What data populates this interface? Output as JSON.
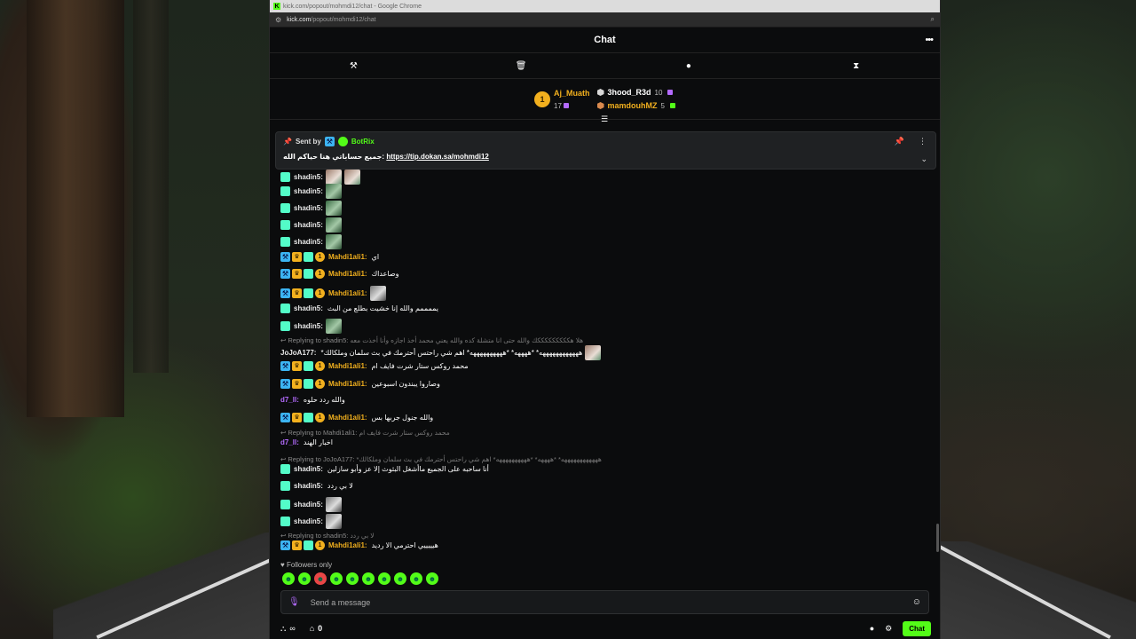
{
  "browser": {
    "title": "kick.com/popout/mohmdi12/chat - Google Chrome",
    "url_host": "kick.com",
    "url_path": "/popout/mohmdi12/chat"
  },
  "header": {
    "title": "Chat"
  },
  "leaderboard": {
    "first": {
      "rank": "1",
      "name": "Aj_Muath",
      "count": "17"
    },
    "second": {
      "name": "3hood_R3d",
      "count": "10"
    },
    "third": {
      "name": "mamdouhMZ",
      "count": "5"
    }
  },
  "pinned": {
    "sent_by": "Sent by",
    "bot": "BotRix",
    "text": "جميع حساباتي هنا حياكم الله:",
    "link": "https://tip.dokan.sa/mohmdi12"
  },
  "messages": [
    {
      "user": "shadin5:",
      "text": ""
    },
    {
      "user": "shadin5:",
      "text": ""
    },
    {
      "user": "shadin5:",
      "text": ""
    },
    {
      "user": "shadin5:",
      "text": ""
    },
    {
      "user": "shadin5:",
      "text": ""
    },
    {
      "user": "Mahdi1ali1:",
      "text": "اي"
    },
    {
      "user": "Mahdi1ali1:",
      "text": "وصاعداك"
    },
    {
      "user": "Mahdi1ali1:",
      "text": ""
    },
    {
      "user": "shadin5:",
      "text": "يممممم والله إنا خشيت بطلع من البث"
    },
    {
      "user": "shadin5:",
      "text": ""
    },
    {
      "user": "JoJoA177:",
      "text": "*ههههههههههههه* *ههههه* *ههههههههههه* اهم شي راحتس أحترمك في بث سلمان وملكالك"
    },
    {
      "user": "Mahdi1ali1:",
      "text": "محمد روكس ستار شرت فايف ام"
    },
    {
      "user": "Mahdi1ali1:",
      "text": "وصاروا يبندون اسبوعين"
    },
    {
      "user": "d7_ll:",
      "text": "والله ردد حلوه"
    },
    {
      "user": "Mahdi1ali1:",
      "text": "والله جنول جربها بس"
    },
    {
      "user": "d7_ll:",
      "text": "اخبار الهند"
    },
    {
      "user": "shadin5:",
      "text": "أنا ساحبه على الجميع ماأشغل البثوث إلا عز وأبو سازلين"
    },
    {
      "user": "shadin5:",
      "text": "لا بي ردد"
    },
    {
      "user": "shadin5:",
      "text": ""
    },
    {
      "user": "shadin5:",
      "text": ""
    },
    {
      "user": "Mahdi1ali1:",
      "text": "هيييييي احترمي الا رديد"
    }
  ],
  "replies": [
    {
      "label": "Replying to shadin5:",
      "context": "هلا هكككككككككك والله حتى انا متشلة كده والله يعني محمد أخذ اجازه وأنا أخذت معه"
    },
    {
      "label": "Replying to Mahdi1ali1:",
      "context": "محمد روكس ستار شرت فايف ام"
    },
    {
      "label": "Replying to JoJoA177:",
      "context": "*ههههههههههههه* *ههههه* *ههههههههههه* اهم شي راحتس أحترمك في بث سلمان وملكالك"
    },
    {
      "label": "Replying to shadin5:",
      "context": "لا بي ردد"
    }
  ],
  "composer": {
    "followers_only": "Followers only",
    "placeholder": "Send a message",
    "points": "0",
    "chat_button": "Chat"
  },
  "colors": {
    "accent": "#53fc18",
    "vip": "#f2b01e",
    "sub": "#53fcc8",
    "mod": "#3cb4f2"
  }
}
